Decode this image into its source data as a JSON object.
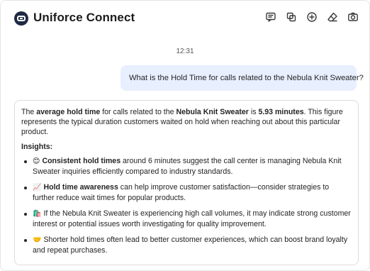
{
  "app": {
    "title": "Uniforce Connect"
  },
  "toolbar": [
    {
      "name": "chat-icon"
    },
    {
      "name": "copy-icon"
    },
    {
      "name": "new-chat-icon"
    },
    {
      "name": "eraser-icon"
    },
    {
      "name": "camera-icon"
    }
  ],
  "conversation": {
    "timestamp": "12:31",
    "user_message": "What is the Hold Time for calls related to the Nebula Knit Sweater?",
    "answer": {
      "p1_pre": "The ",
      "p1_b1": "average hold time",
      "p1_mid1": " for calls related to the ",
      "p1_b2": "Nebula Knit Sweater",
      "p1_mid2": " is ",
      "p1_b3": "5.93 minutes",
      "p1_post": ". This figure represents the typical duration customers waited on hold when reaching out about this particular product.",
      "insights_heading": "Insights:",
      "insights": [
        {
          "emoji": "😊",
          "bold": "Consistent hold times",
          "text": " around 6 minutes suggest the call center is managing Nebula Knit Sweater inquiries efficiently compared to industry standards."
        },
        {
          "emoji": "📈",
          "bold": "Hold time awareness",
          "text": " can help improve customer satisfaction—consider strategies to further reduce wait times for popular products."
        },
        {
          "emoji": "🛍️",
          "bold": "",
          "text": "If the Nebula Knit Sweater is experiencing high call volumes, it may indicate strong customer interest or potential issues worth investigating for quality improvement."
        },
        {
          "emoji": "🤝",
          "bold": "",
          "text": "Shorter hold times often lead to better customer experiences, which can boost brand loyalty and repeat purchases."
        }
      ]
    }
  }
}
